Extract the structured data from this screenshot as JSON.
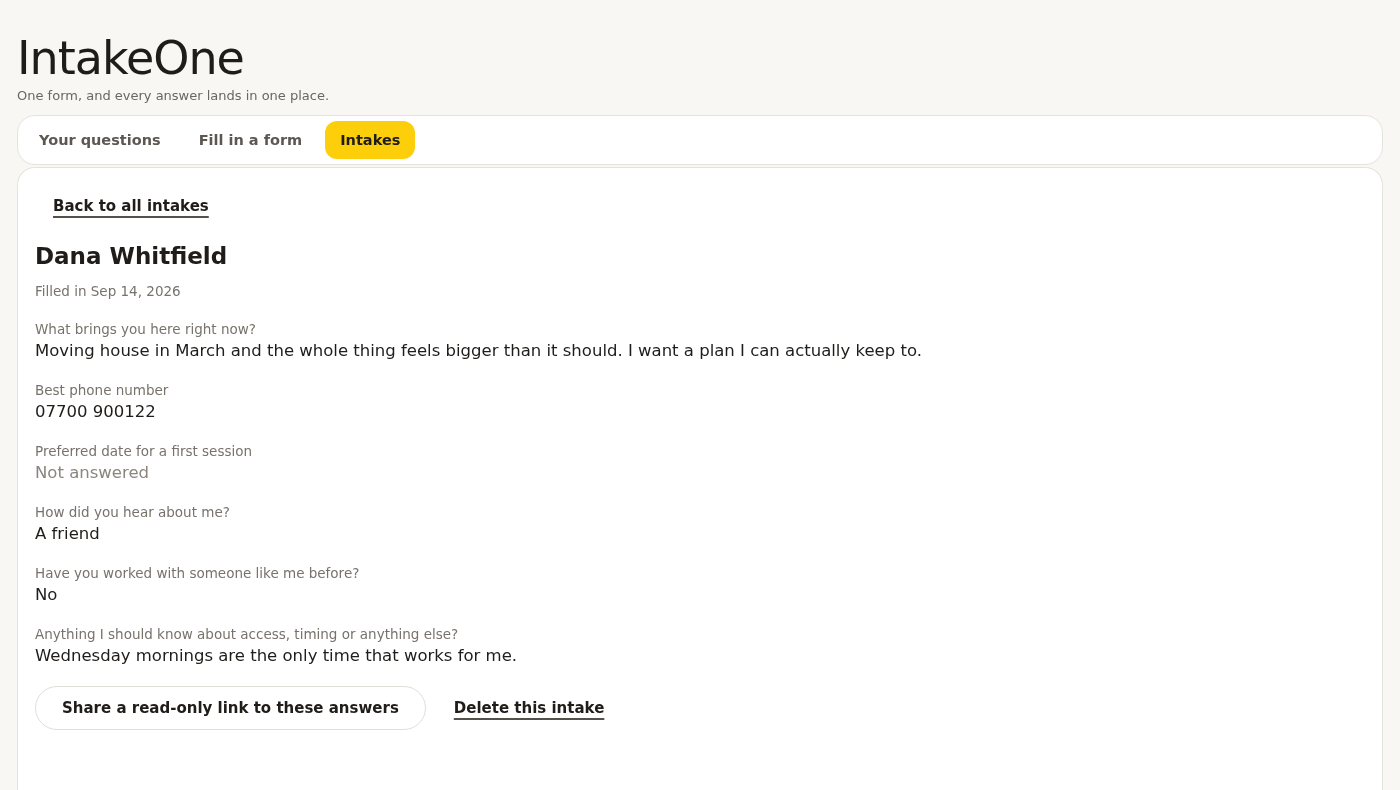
{
  "app": {
    "title": "IntakeOne",
    "tagline": "One form, and every answer lands in one place."
  },
  "tabs": [
    {
      "label": "Your questions",
      "selected": false
    },
    {
      "label": "Fill in a form",
      "selected": false
    },
    {
      "label": "Intakes",
      "selected": true
    }
  ],
  "intake": {
    "back_link": "Back to all intakes",
    "name": "Dana Whitfield",
    "filled_in": "Filled in Sep 14, 2026",
    "answers": [
      {
        "question": "What brings you here right now?",
        "answer": "Moving house in March and the whole thing feels bigger than it should. I want a plan I can actually keep to.",
        "answered": true
      },
      {
        "question": "Best phone number",
        "answer": "07700 900122",
        "answered": true
      },
      {
        "question": "Preferred date for a first session",
        "answer": "Not answered",
        "answered": false
      },
      {
        "question": "How did you hear about me?",
        "answer": "A friend",
        "answered": true
      },
      {
        "question": "Have you worked with someone like me before?",
        "answer": "No",
        "answered": true
      },
      {
        "question": "Anything I should know about access, timing or anything else?",
        "answer": "Wednesday mornings are the only time that works for me.",
        "answered": true
      }
    ],
    "share_button": "Share a read-only link to these answers",
    "delete_link": "Delete this intake"
  }
}
